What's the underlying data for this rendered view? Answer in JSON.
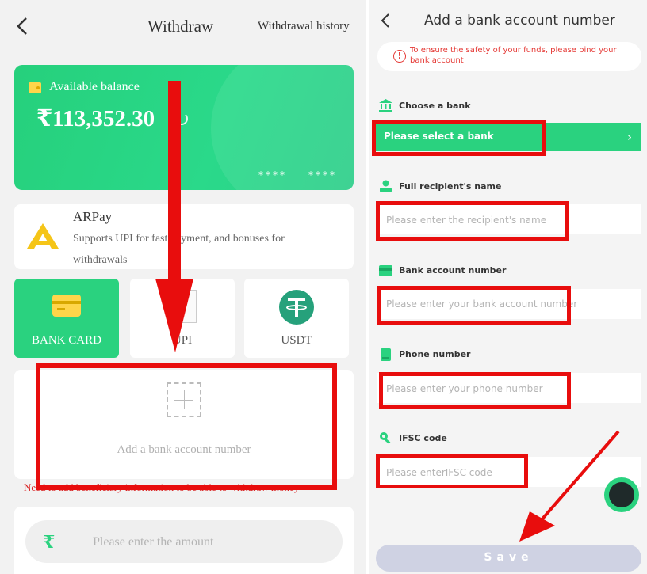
{
  "left": {
    "title": "Withdraw",
    "history_link": "Withdrawal history",
    "balance": {
      "label": "Available balance",
      "amount": "₹113,352.30",
      "masked_1": "****",
      "masked_2": "****"
    },
    "arpay": {
      "name": "ARPay",
      "description": "Supports UPI for fast payment, and bonuses for withdrawals"
    },
    "methods": [
      {
        "label": "BANK CARD",
        "active": true
      },
      {
        "label": "UPI",
        "active": false
      },
      {
        "label": "USDT",
        "active": false
      }
    ],
    "add_bank": "Add a bank account number",
    "warning": "Need to add beneficiary information to be able to withdraw money",
    "amount_placeholder": "Please enter the amount",
    "currency_symbol": "₹"
  },
  "right": {
    "title": "Add a bank account number",
    "safety_notice": "To ensure the safety of your funds, please bind your bank account",
    "bank": {
      "label": "Choose a bank",
      "placeholder": "Please select a bank"
    },
    "name": {
      "label": "Full recipient's name",
      "placeholder": "Please enter the recipient's name"
    },
    "account": {
      "label": "Bank account number",
      "placeholder": "Please enter your bank account number"
    },
    "phone": {
      "label": "Phone number",
      "placeholder": "Please enter your phone number"
    },
    "ifsc": {
      "label": "IFSC code",
      "placeholder": "Please enterIFSC code"
    },
    "save_label": "Save"
  },
  "colors": {
    "primary_green": "#2ad27f",
    "warning_red": "#e53935",
    "annotation_red": "#e80d0d",
    "save_disabled": "#cfd2e3"
  }
}
